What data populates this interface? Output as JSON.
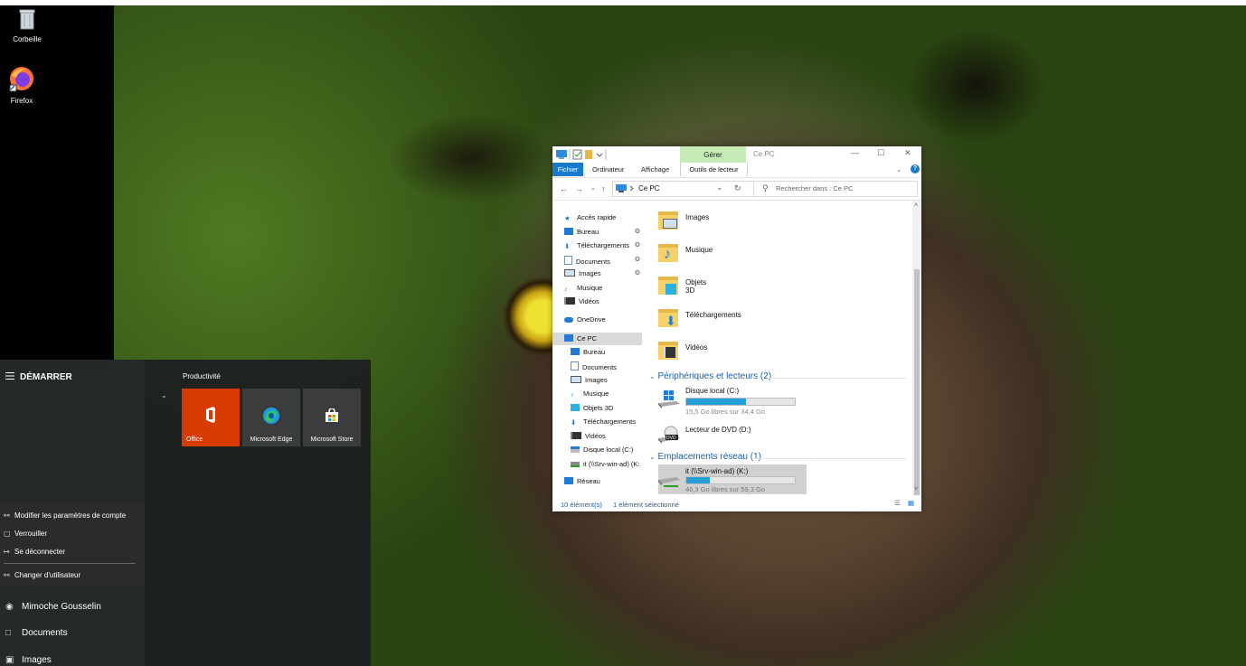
{
  "desktop": {
    "icons": [
      {
        "label": "Corbeille",
        "icon": "recycle-bin-icon"
      },
      {
        "label": "Firefox",
        "icon": "firefox-icon"
      }
    ]
  },
  "start_menu": {
    "title": "DÉMARRER",
    "group_label": "Productivité",
    "tiles": [
      {
        "label": "Office",
        "icon": "office-icon",
        "color": "#d83b01"
      },
      {
        "label": "Microsoft Edge",
        "icon": "edge-icon",
        "color": "#3a3c3e"
      },
      {
        "label": "Microsoft Store",
        "icon": "store-icon",
        "color": "#3a3c3e"
      }
    ],
    "account_menu": [
      "Modifier les paramètres de compte",
      "Verrouiller",
      "Se déconnecter",
      "Changer d'utilisateur"
    ],
    "rail_items": [
      {
        "label": "Mimoche Gousselin",
        "icon": "user-avatar-icon"
      },
      {
        "label": "Documents",
        "icon": "document-icon"
      },
      {
        "label": "Images",
        "icon": "image-icon"
      }
    ]
  },
  "explorer": {
    "title": "Ce PC",
    "contextual_tab": "Gérer",
    "ribbon_tabs": [
      "Fichier",
      "Ordinateur",
      "Affichage",
      "Outils de lecteur"
    ],
    "address": "Ce PC",
    "search_placeholder": "Rechercher dans : Ce PC",
    "nav": {
      "quick_access": "Accès rapide",
      "quick_items": [
        "Bureau",
        "Téléchargements",
        "Documents",
        "Images",
        "Musique",
        "Vidéos"
      ],
      "onedrive": "OneDrive",
      "this_pc": "Ce PC",
      "pc_items": [
        "Bureau",
        "Documents",
        "Images",
        "Musique",
        "Objets 3D",
        "Téléchargements",
        "Vidéos",
        "Disque local (C:)",
        "it (\\\\Srv-win-ad) (K:"
      ],
      "network": "Réseau"
    },
    "folders": [
      "Images",
      "Musique",
      "Objets 3D",
      "Téléchargements",
      "Vidéos"
    ],
    "group_devices": "Périphériques et lecteurs (2)",
    "drives": [
      {
        "name": "Disque local (C:)",
        "free": "15,5 Go libres sur 34,4 Go",
        "used_fraction": 0.55
      },
      {
        "name": "Lecteur de DVD (D:)",
        "free": ""
      }
    ],
    "group_network": "Emplacements réseau (1)",
    "network_drives": [
      {
        "name": "it (\\\\Srv-win-ad) (K:)",
        "free": "46,3 Go libres sur 59,3 Go",
        "used_fraction": 0.22
      }
    ],
    "status_count": "10 élément(s)",
    "status_selected": "1 élément sélectionné"
  }
}
